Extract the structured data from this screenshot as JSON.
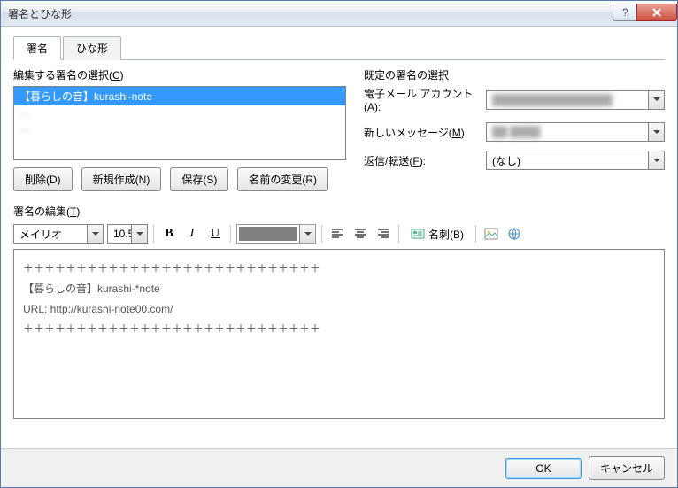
{
  "window": {
    "title": "署名とひな形"
  },
  "tabs": {
    "signature": "署名",
    "template": "ひな形"
  },
  "select_group": {
    "label_pre": "編集する署名の選択(",
    "label_key": "C",
    "label_post": ")",
    "items": [
      {
        "text": "【暮らしの音】kurashi-note",
        "selected": true
      },
      {
        "text": "—",
        "selected": false,
        "blur": true
      },
      {
        "text": "—",
        "selected": false,
        "blur": true
      }
    ]
  },
  "buttons": {
    "delete": "削除(D)",
    "new": "新規作成(N)",
    "save": "保存(S)",
    "rename": "名前の変更(R)"
  },
  "defaults": {
    "label": "既定の署名の選択",
    "account_label_pre": "電子メール アカウント(",
    "account_key": "A",
    "account_label_post": "):",
    "account_value": "████████████████",
    "newmsg_label_pre": "新しいメッセージ(",
    "newmsg_key": "M",
    "newmsg_label_post": "):",
    "newmsg_value": "██ ████",
    "reply_label_pre": "返信/転送(",
    "reply_key": "F",
    "reply_label_post": "):",
    "reply_value": "(なし)"
  },
  "edit": {
    "label_pre": "署名の編集(",
    "label_key": "T",
    "label_post": ")",
    "font": "メイリオ",
    "size": "10.5",
    "biz_card": "名刺(B)"
  },
  "editor_text": "＋＋＋＋＋＋＋＋＋＋＋＋＋＋＋＋＋＋＋＋＋＋＋＋＋＋＋＋\n【暮らしの音】kurashi-*note\nURL: http://kurashi-note00.com/\n＋＋＋＋＋＋＋＋＋＋＋＋＋＋＋＋＋＋＋＋＋＋＋＋＋＋＋＋",
  "footer": {
    "ok": "OK",
    "cancel": "キャンセル"
  }
}
